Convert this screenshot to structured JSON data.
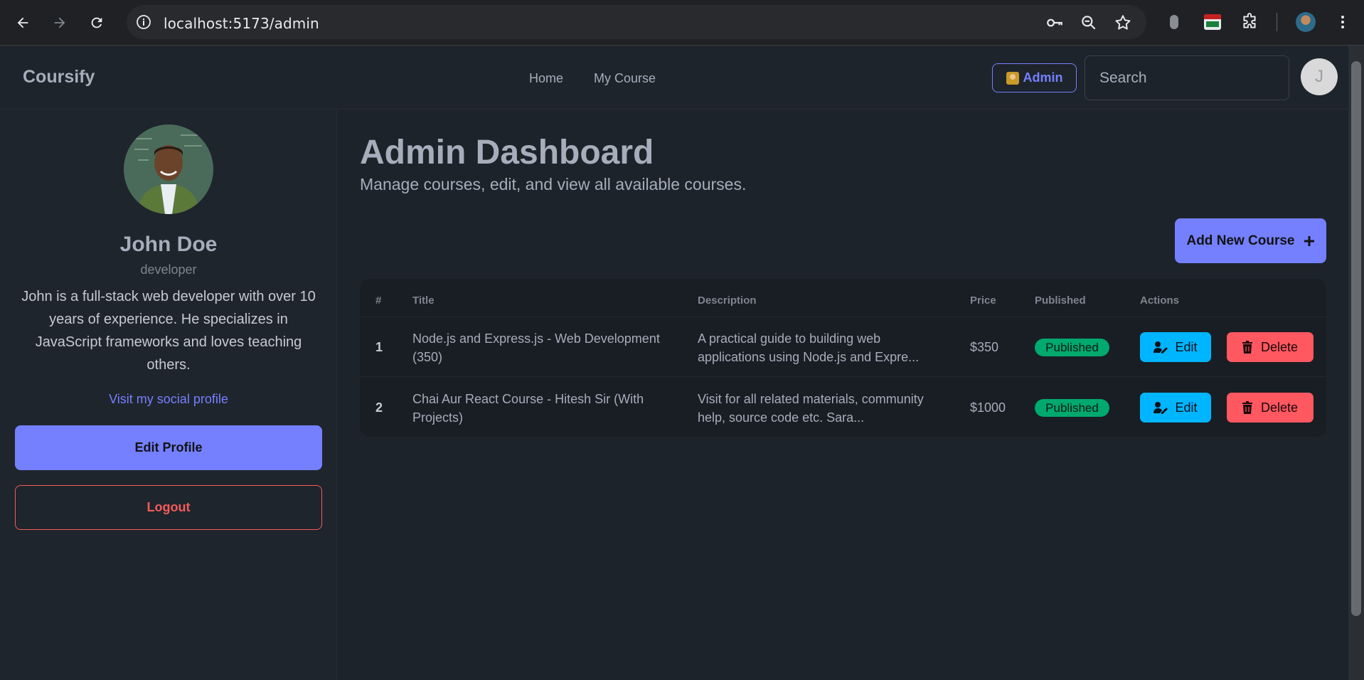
{
  "browser": {
    "url": "localhost:5173/admin"
  },
  "navbar": {
    "brand": "Coursify",
    "links": [
      "Home",
      "My Course"
    ],
    "admin_label": "Admin",
    "search_placeholder": "Search",
    "avatar_initial": "J"
  },
  "profile": {
    "name": "John Doe",
    "role": "developer",
    "bio": "John is a full-stack web developer with over 10 years of experience. He specializes in JavaScript frameworks and loves teaching others.",
    "social_link": "Visit my social profile",
    "edit_label": "Edit Profile",
    "logout_label": "Logout"
  },
  "dashboard": {
    "title": "Admin Dashboard",
    "subtitle": "Manage courses, edit, and view all available courses.",
    "add_label": "Add New Course"
  },
  "table": {
    "headers": [
      "#",
      "Title",
      "Description",
      "Price",
      "Published",
      "Actions"
    ],
    "rows": [
      {
        "index": "1",
        "title": "Node.js and Express.js - Web Development (350)",
        "description": "A practical guide to building web applications using Node.js and Expre...",
        "price": "$350",
        "status": "Published",
        "edit": "Edit",
        "delete": "Delete"
      },
      {
        "index": "2",
        "title": "Chai Aur React Course - Hitesh Sir (With Projects)",
        "description": "Visit for all related materials, community help, source code etc. Sara...",
        "price": "$1000",
        "status": "Published",
        "edit": "Edit",
        "delete": "Delete"
      }
    ]
  },
  "colors": {
    "primary": "#7480ff",
    "success": "#00a96e",
    "info": "#00b5ff",
    "error": "#ff5861",
    "background": "#1d232a"
  }
}
